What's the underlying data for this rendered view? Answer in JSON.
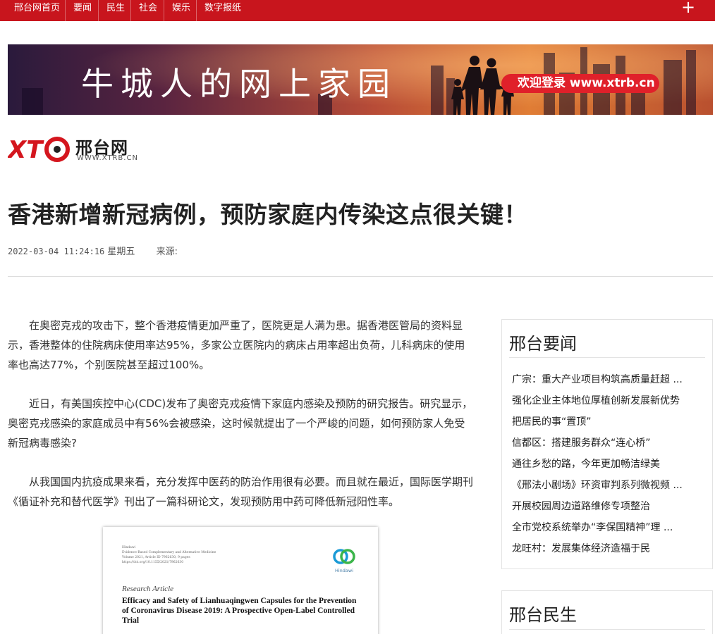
{
  "nav": {
    "items": [
      "邢台网首页",
      "要闻",
      "民生",
      "社会",
      "娱乐",
      "数字报纸"
    ],
    "plus_icon": "plus-icon",
    "bg_color": "#c8151d"
  },
  "banner": {
    "slogan": "牛城人的网上家园",
    "cta": "欢迎登录 www.xtrb.cn"
  },
  "logo": {
    "mark": "XTB",
    "name": "邢台网",
    "url": "WWW.XTRB.CN"
  },
  "article": {
    "title": "香港新增新冠病例，预防家庭内传染这点很关键！",
    "datetime": "2022-03-04 11:24:16",
    "weekday": "星期五",
    "source_label": "来源:",
    "paragraphs": [
      "在奥密克戎的攻击下，整个香港疫情更加严重了，医院更是人满为患。据香港医管局的资料显示，香港整体的住院病床使用率达95%，多家公立医院内的病床占用率超出负荷，儿科病床的使用率也高达77%，个别医院甚至超过100%。",
      "近日，有美国疾控中心(CDC)发布了奥密克戎疫情下家庭内感染及预防的研究报告。研究显示，奥密克戎感染的家庭成员中有56%会被感染，这时候就提出了一个严峻的问题，如何预防家人免受新冠病毒感染?",
      "从我国国内抗疫成果来看，充分发挥中医药的防治作用很有必要。而且就在最近，国际医学期刊《循证补充和替代医学》刊出了一篇科研论文，发现预防用中药可降低新冠阳性率。"
    ],
    "image": {
      "header_lines": "Hindawi\nEvidence-Based Complementary and Alternative Medicine\nVolume 2021, Article ID 7962630, 9 pages\nhttps://doi.org/10.1155/2021/7962630",
      "publisher": "Hindawi",
      "type_label": "Research Article",
      "paper_title": "Efficacy and Safety of Lianhuaqingwen Capsules for the Prevention of Coronavirus Disease 2019: A Prospective Open-Label Controlled Trial"
    }
  },
  "sidebar": {
    "news": {
      "heading": "邢台要闻",
      "items": [
        "广宗：重大产业项目构筑高质量赶超 ...",
        "强化企业主体地位厚植创新发展新优势",
        "把居民的事“置顶”",
        "信都区：搭建服务群众“连心桥”",
        "通往乡愁的路，今年更加畅洁绿美",
        "《邢法小剧场》环资审判系列微视频 ...",
        "开展校园周边道路维修专项整治",
        "全市党校系统举办“李保国精神”理 ...",
        "龙旺村：发展集体经济造福于民"
      ]
    },
    "livelihood": {
      "heading": "邢台民生"
    }
  }
}
